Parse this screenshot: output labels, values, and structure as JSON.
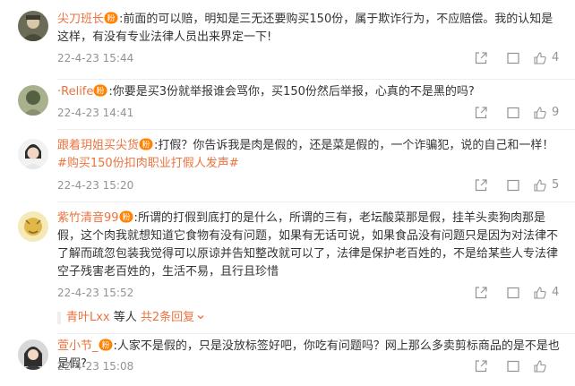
{
  "comments": [
    {
      "username": "尖刀班长",
      "text": "前面的可以赔，明知是三无还要购买150份，属于欺诈行为，不应赔偿。我的认知是这样，有没有专业法律人员出来界定一下!",
      "time": "22-4-23 15:44",
      "likes": "4",
      "hashtag": ""
    },
    {
      "username": "·Relife",
      "text": "你要是买3份就举报谁会骂你，买150份然后举报，心真的不是黑的吗?",
      "time": "22-4-23 14:41",
      "likes": "9",
      "hashtag": ""
    },
    {
      "username": "跟着玥姐买尖货",
      "text": "打假？你告诉我是肉是假的，还是菜是假的，一个诈骗犯，说的自己和一样！",
      "hashtag": "#购买150份扣肉职业打假人发声#",
      "time": "22-4-23 15:20",
      "likes": "5"
    },
    {
      "username": "紫竹清音99",
      "text": "所谓的打假到底打的是什么，所谓的三有，老坛酸菜那是假，挂羊头卖狗肉那是假，这个肉我就想知道它食物有没有问题，如果有无话可说，如果食品没有问题只是因为对法律不了解而疏忽包装我觉得可以原谅并告知整改就可以了，法律是保护老百姓的，不是给某些人专法律空子残害老百姓的，生活不易，且行且珍惜",
      "time": "22-4-23 15:52",
      "likes": "4",
      "hashtag": "",
      "sub": {
        "user": "青叶Lxx",
        "mid": " 等人 ",
        "total": "共2条回复"
      }
    },
    {
      "username": "萱小节_",
      "text": "人家不是假的，只是没放标签好吧，你吃有问题吗？网上那么多卖剪标商品的是不是也是假?",
      "time": "22-4-23 15:08",
      "likes": "",
      "hashtag": ""
    }
  ],
  "colors": {
    "accent": "#eb7340",
    "meta": "#939393",
    "text": "#333333"
  },
  "icons": {
    "badge": "fans-badge-icon",
    "share": "share-icon",
    "reply": "comment-icon",
    "like": "thumb-up-icon"
  }
}
